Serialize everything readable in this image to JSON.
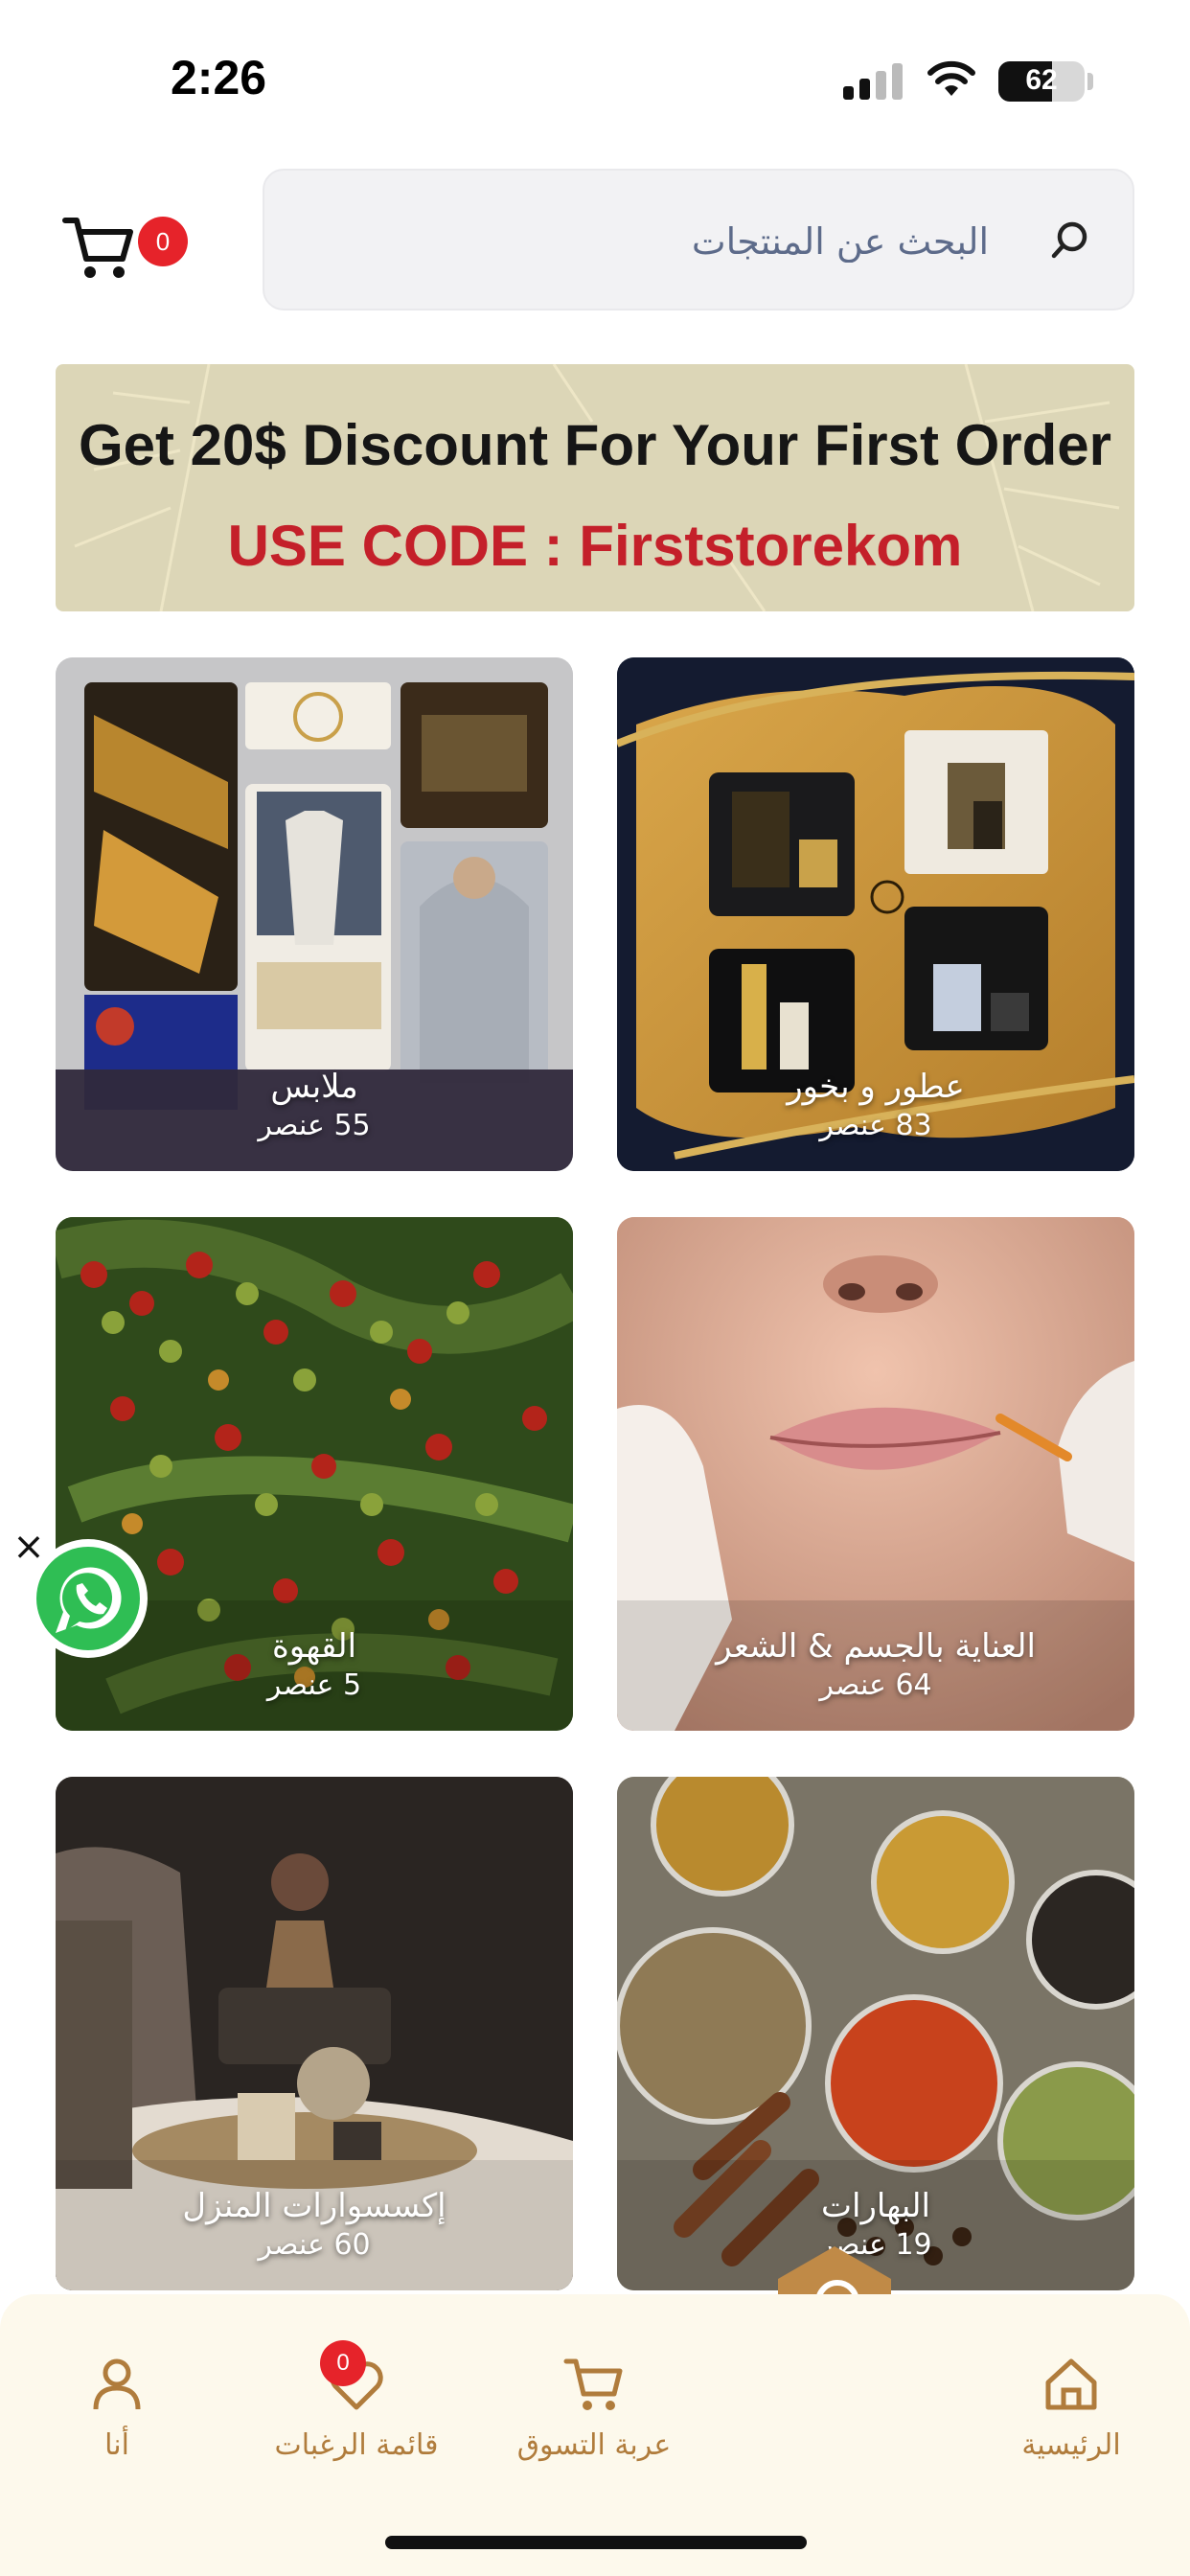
{
  "status_bar": {
    "time": "2:26",
    "battery": "62",
    "battery_level_percent": 62
  },
  "header": {
    "cart_count": "0",
    "search_placeholder": "البحث عن المنتجات"
  },
  "promo": {
    "line1": "Get 20$ Discount For Your First Order",
    "line2": "USE CODE : Firststorekom"
  },
  "categories": [
    {
      "title": "عطور و بخور",
      "count": "83 عنصر"
    },
    {
      "title": "ملابس",
      "count": "55 عنصر"
    },
    {
      "title": "العناية بالجسم & الشعر",
      "count": "64 عنصر"
    },
    {
      "title": "القهوة",
      "count": "5 عنصر"
    },
    {
      "title": "البهارات",
      "count": "19 عنصر"
    },
    {
      "title": "إكسسوارات المنزل",
      "count": "60 عنصر"
    }
  ],
  "floating": {
    "close_glyph": "×"
  },
  "bottom_nav": {
    "items": [
      {
        "label": "الرئيسية",
        "icon": "home-icon"
      },
      {
        "label": "عربة التسوق",
        "icon": "cart-icon"
      },
      {
        "label": "قائمة الرغبات",
        "icon": "heart-icon",
        "badge": "0"
      },
      {
        "label": "أنا",
        "icon": "user-icon"
      }
    ],
    "center_button_icon": "search-icon"
  },
  "colors": {
    "accent": "#b07c3c",
    "badge": "#e6232a",
    "promo_bg": "#dcd6b7",
    "promo_code": "#c4202a",
    "nav_bg": "#fdf9ec"
  }
}
